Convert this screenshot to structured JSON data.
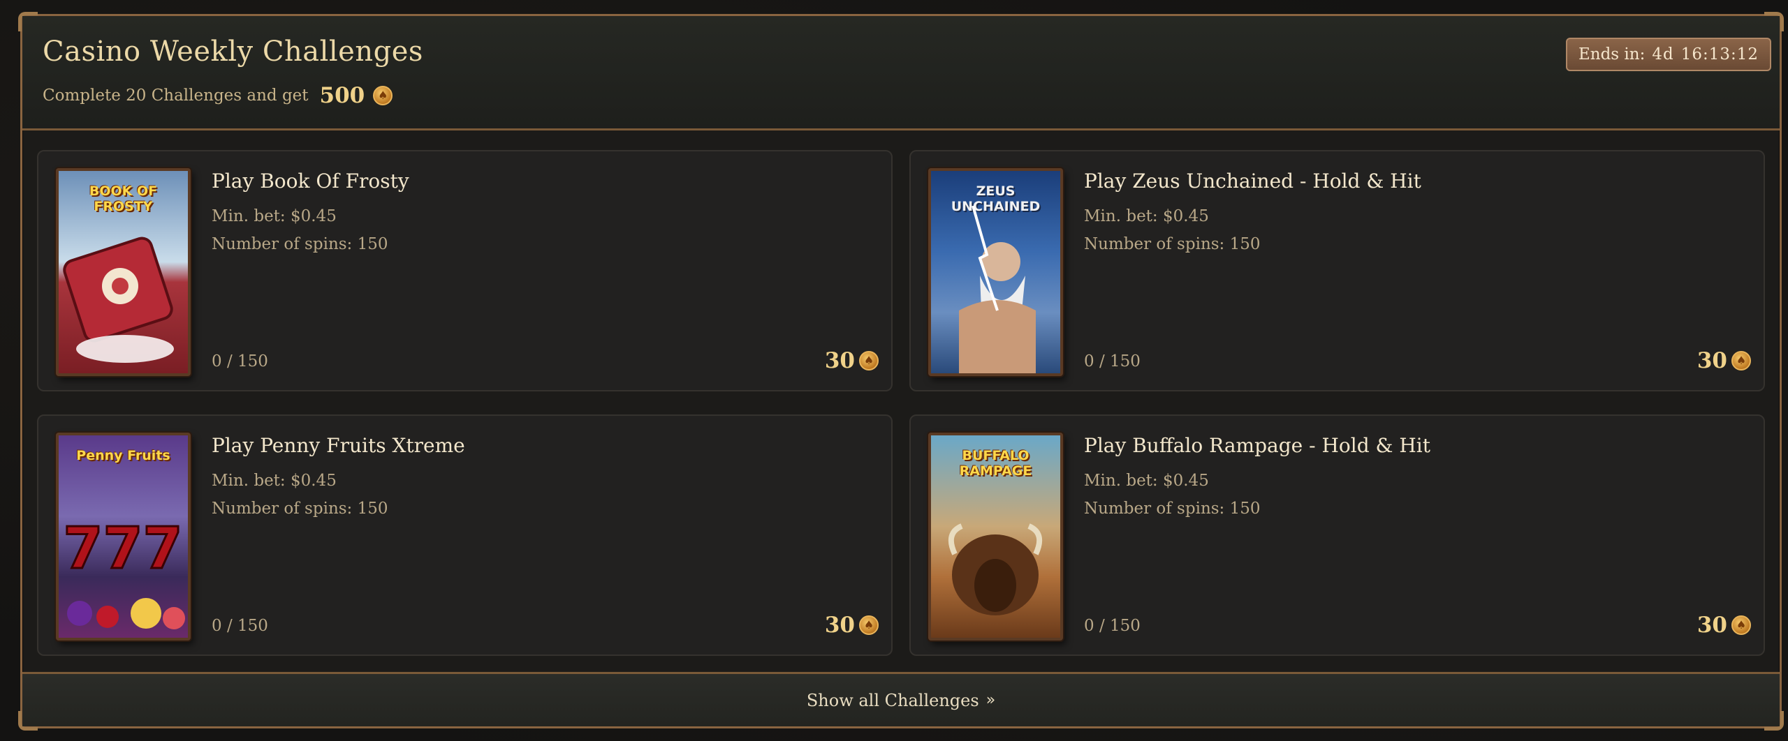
{
  "header": {
    "title": "Casino Weekly Challenges",
    "subtitle": "Complete 20 Challenges and get",
    "total_reward": "500",
    "timer_label": "Ends in:",
    "timer_days": "4d",
    "timer_time": "16:13:12"
  },
  "challenges": [
    {
      "name": "Play Book Of Frosty",
      "thumb_label": "BOOK OF FROSTY",
      "min_bet": "Min. bet: $0.45",
      "spins": "Number of spins: 150",
      "progress": "0 / 150",
      "reward": "30"
    },
    {
      "name": "Play Zeus Unchained - Hold & Hit",
      "thumb_label": "ZEUS UNCHAINED",
      "min_bet": "Min. bet: $0.45",
      "spins": "Number of spins: 150",
      "progress": "0 / 150",
      "reward": "30"
    },
    {
      "name": "Play Penny Fruits Xtreme",
      "thumb_label": "Penny Fruits",
      "min_bet": "Min. bet: $0.45",
      "spins": "Number of spins: 150",
      "progress": "0 / 150",
      "reward": "30"
    },
    {
      "name": "Play Buffalo Rampage - Hold & Hit",
      "thumb_label": "BUFFALO RAMPAGE",
      "min_bet": "Min. bet: $0.45",
      "spins": "Number of spins: 150",
      "progress": "0 / 150",
      "reward": "30"
    }
  ],
  "footer": {
    "show_all_label": "Show all Challenges"
  },
  "icons": {
    "coin": "spade-coin-icon",
    "chevron": "double-chevron-right-icon"
  },
  "colors": {
    "accent_gold": "#f0d28a",
    "border_bronze": "#8a6440",
    "card_bg": "#222120"
  }
}
